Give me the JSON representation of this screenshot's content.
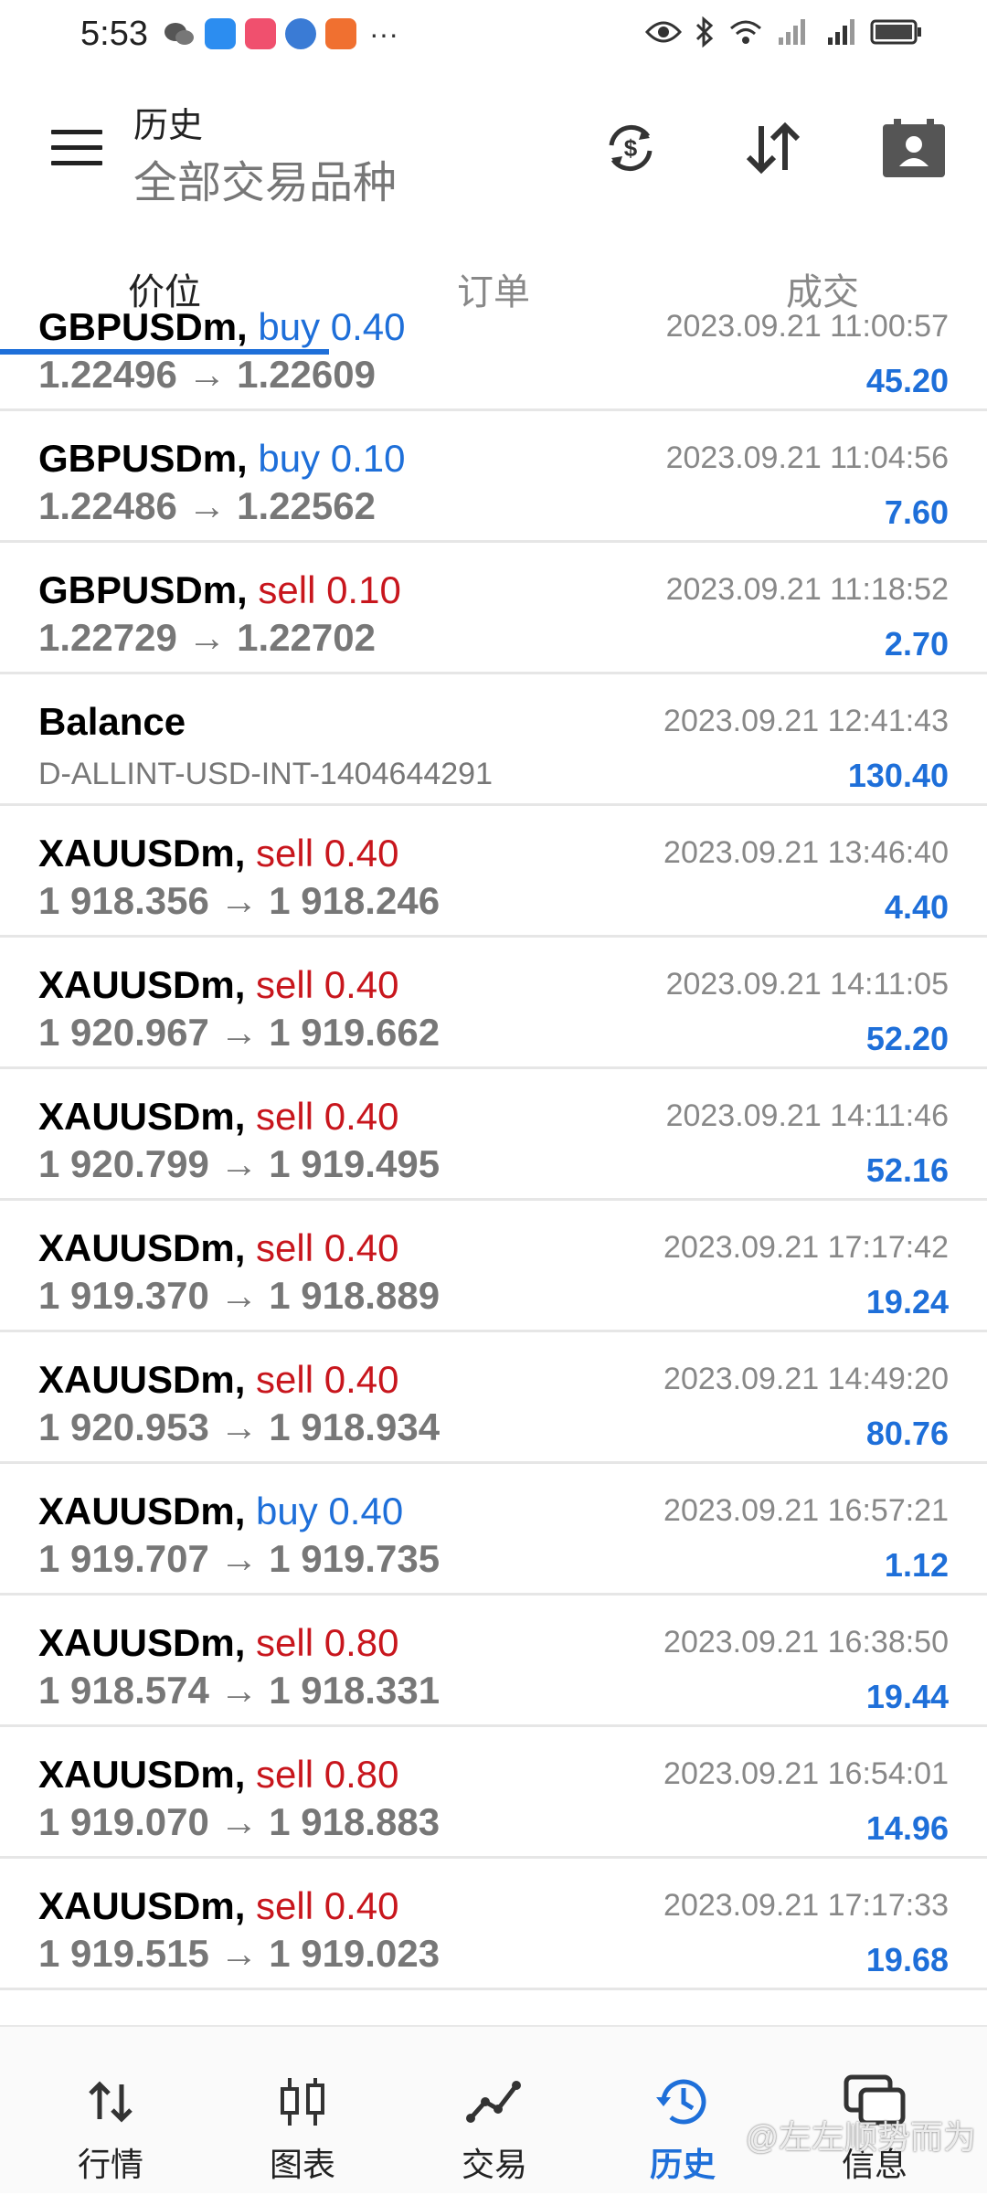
{
  "status_bar": {
    "time": "5:53",
    "more": "···"
  },
  "header": {
    "title": "历史",
    "subtitle": "全部交易品种"
  },
  "tabs": [
    {
      "label": "价位",
      "active": true
    },
    {
      "label": "订单",
      "active": false
    },
    {
      "label": "成交",
      "active": false
    }
  ],
  "deals": [
    {
      "symbol": "GBPUSDm,",
      "side": "buy",
      "volume": "buy 0.40",
      "price_from": "1.22496",
      "price_to": "1.22609",
      "time": "2023.09.21 11:00:57",
      "profit": "45.20"
    },
    {
      "symbol": "GBPUSDm,",
      "side": "buy",
      "volume": "buy 0.10",
      "price_from": "1.22486",
      "price_to": "1.22562",
      "time": "2023.09.21 11:04:56",
      "profit": "7.60"
    },
    {
      "symbol": "GBPUSDm,",
      "side": "sell",
      "volume": "sell 0.10",
      "price_from": "1.22729",
      "price_to": "1.22702",
      "time": "2023.09.21 11:18:52",
      "profit": "2.70"
    },
    {
      "symbol": "Balance",
      "side": "balance",
      "description": "D-ALLINT-USD-INT-1404644291",
      "time": "2023.09.21 12:41:43",
      "profit": "130.40"
    },
    {
      "symbol": "XAUUSDm,",
      "side": "sell",
      "volume": "sell 0.40",
      "price_from": "1 918.356",
      "price_to": "1 918.246",
      "time": "2023.09.21 13:46:40",
      "profit": "4.40"
    },
    {
      "symbol": "XAUUSDm,",
      "side": "sell",
      "volume": "sell 0.40",
      "price_from": "1 920.967",
      "price_to": "1 919.662",
      "time": "2023.09.21 14:11:05",
      "profit": "52.20"
    },
    {
      "symbol": "XAUUSDm,",
      "side": "sell",
      "volume": "sell 0.40",
      "price_from": "1 920.799",
      "price_to": "1 919.495",
      "time": "2023.09.21 14:11:46",
      "profit": "52.16"
    },
    {
      "symbol": "XAUUSDm,",
      "side": "sell",
      "volume": "sell 0.40",
      "price_from": "1 919.370",
      "price_to": "1 918.889",
      "time": "2023.09.21 17:17:42",
      "profit": "19.24"
    },
    {
      "symbol": "XAUUSDm,",
      "side": "sell",
      "volume": "sell 0.40",
      "price_from": "1 920.953",
      "price_to": "1 918.934",
      "time": "2023.09.21 14:49:20",
      "profit": "80.76"
    },
    {
      "symbol": "XAUUSDm,",
      "side": "buy",
      "volume": "buy 0.40",
      "price_from": "1 919.707",
      "price_to": "1 919.735",
      "time": "2023.09.21 16:57:21",
      "profit": "1.12"
    },
    {
      "symbol": "XAUUSDm,",
      "side": "sell",
      "volume": "sell 0.80",
      "price_from": "1 918.574",
      "price_to": "1 918.331",
      "time": "2023.09.21 16:38:50",
      "profit": "19.44"
    },
    {
      "symbol": "XAUUSDm,",
      "side": "sell",
      "volume": "sell 0.80",
      "price_from": "1 919.070",
      "price_to": "1 918.883",
      "time": "2023.09.21 16:54:01",
      "profit": "14.96"
    },
    {
      "symbol": "XAUUSDm,",
      "side": "sell",
      "volume": "sell 0.40",
      "price_from": "1 919.515",
      "price_to": "1 919.023",
      "time": "2023.09.21 17:17:33",
      "profit": "19.68"
    }
  ],
  "arrow": "→",
  "nav": [
    {
      "label": "行情",
      "icon": "quotes-arrows-icon",
      "active": false
    },
    {
      "label": "图表",
      "icon": "candlestick-chart-icon",
      "active": false
    },
    {
      "label": "交易",
      "icon": "trade-line-icon",
      "active": false
    },
    {
      "label": "历史",
      "icon": "history-clock-icon",
      "active": true
    },
    {
      "label": "信息",
      "icon": "messages-icon",
      "active": false
    }
  ],
  "watermark": "@左左顺势而为",
  "colors": {
    "accent": "#1E6FD9",
    "sell": "#C8161D",
    "buy": "#1E6FD9",
    "price": "#777777"
  }
}
